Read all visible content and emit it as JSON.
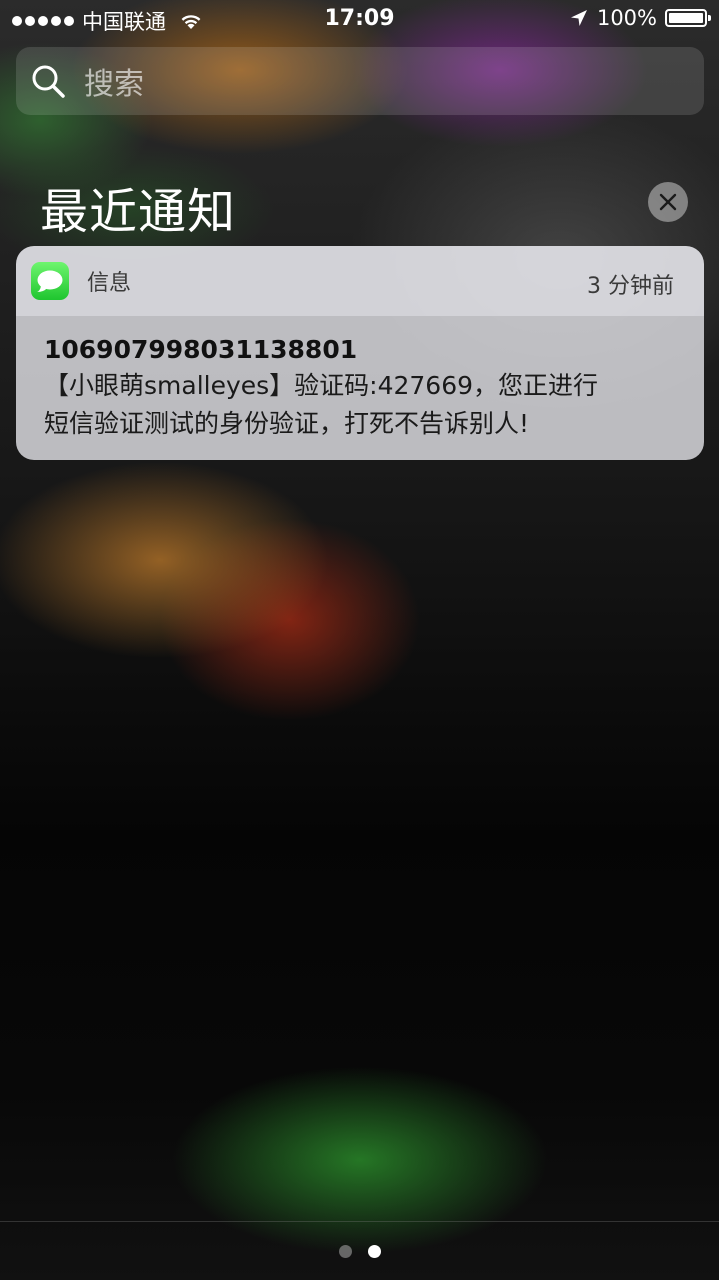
{
  "status_bar": {
    "carrier": "中国联通",
    "time": "17:09",
    "battery_percent": "100%",
    "signal_strength": 5,
    "icons": [
      "signal-dots-icon",
      "wifi-icon",
      "location-arrow-icon",
      "battery-icon"
    ]
  },
  "search": {
    "placeholder": "搜索",
    "icon": "search-icon"
  },
  "notifications_section": {
    "title": "最近通知",
    "clear_icon": "close-icon"
  },
  "notification": {
    "app_name": "信息",
    "app_icon": "messages-app-icon",
    "time": "3 分钟前",
    "sender": "10690799803113880 1",
    "message_line1": "【小眼萌smalleyes】验证码:427669，您正进行",
    "message_line2": "短信验证测试的身份验证，打死不告诉别人!",
    "accent_color": "#1fc52f"
  },
  "page_indicator": {
    "page_count": 2,
    "current_page": 2
  }
}
